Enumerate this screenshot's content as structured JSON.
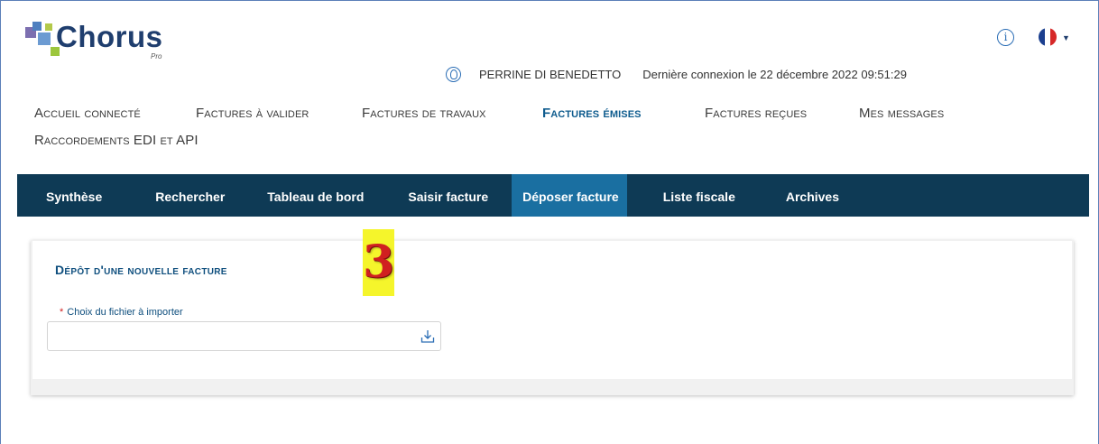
{
  "brand": {
    "name": "Chorus",
    "sub": "Pro"
  },
  "header": {
    "user_name": "PERRINE DI BENEDETTO",
    "last_login": "Dernière connexion le 22 décembre 2022 09:51:29"
  },
  "main_nav": {
    "items": [
      "Accueil connecté",
      "Factures à valider",
      "Factures de travaux",
      "Factures émises",
      "Factures reçues",
      "Mes messages",
      "Raccordements EDI et API"
    ],
    "active": "Factures émises"
  },
  "sub_nav": {
    "tabs": [
      "Synthèse",
      "Rechercher",
      "Tableau de bord",
      "Saisir facture",
      "Déposer facture",
      "Liste fiscale",
      "Archives"
    ],
    "active": "Déposer facture"
  },
  "card": {
    "title": "Dépôt d'une nouvelle facture",
    "step_number": "3",
    "field_required_mark": "*",
    "field_label": "Choix du fichier à importer",
    "field_value": ""
  },
  "colors": {
    "subnav_bg": "#0e3a55",
    "subnav_active": "#1a6fa1",
    "title_blue": "#0f4f7e",
    "step_badge_bg": "#f5f52b",
    "step_number": "#d02020"
  },
  "icons": {
    "info": "info-icon",
    "flag": "french-flag-icon",
    "user": "user-icon",
    "file_import": "download-icon"
  }
}
